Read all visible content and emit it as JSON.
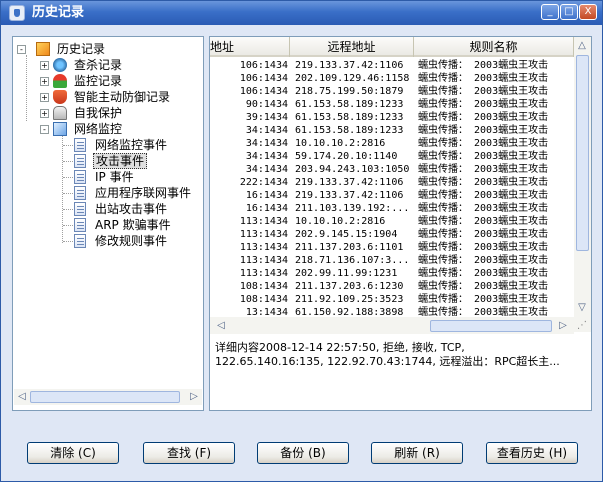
{
  "window": {
    "title": "历史记录",
    "controls": {
      "minimize": "_",
      "maximize": "□",
      "close": "X"
    }
  },
  "tree": {
    "root": {
      "label": "历史记录",
      "icon": "history-folder-icon"
    },
    "children": [
      {
        "label": "查杀记录",
        "icon": "scan-icon",
        "expander": "+"
      },
      {
        "label": "监控记录",
        "icon": "umbrella-icon",
        "expander": "+"
      },
      {
        "label": "智能主动防御记录",
        "icon": "defense-icon",
        "expander": "+"
      },
      {
        "label": "自我保护",
        "icon": "lock-icon",
        "expander": "+"
      },
      {
        "label": "网络监控",
        "icon": "network-icon",
        "expander": "-",
        "children": [
          {
            "label": "网络监控事件"
          },
          {
            "label": "攻击事件",
            "selected": true
          },
          {
            "label": "IP 事件"
          },
          {
            "label": "应用程序联网事件"
          },
          {
            "label": "出站攻击事件"
          },
          {
            "label": "ARP 欺骗事件"
          },
          {
            "label": "修改规则事件"
          }
        ]
      }
    ]
  },
  "grid": {
    "columns": [
      "地址",
      "远程地址",
      "规则名称"
    ],
    "rows": [
      [
        "106:1434",
        "219.133.37.42:1106",
        "蠕虫传播： 2003蠕虫王攻击"
      ],
      [
        "106:1434",
        "202.109.129.46:1158",
        "蠕虫传播： 2003蠕虫王攻击"
      ],
      [
        "106:1434",
        "218.75.199.50:1879",
        "蠕虫传播： 2003蠕虫王攻击"
      ],
      [
        "90:1434",
        "61.153.58.189:1233",
        "蠕虫传播： 2003蠕虫王攻击"
      ],
      [
        "39:1434",
        "61.153.58.189:1233",
        "蠕虫传播： 2003蠕虫王攻击"
      ],
      [
        "34:1434",
        "61.153.58.189:1233",
        "蠕虫传播： 2003蠕虫王攻击"
      ],
      [
        "34:1434",
        "10.10.10.2:2816",
        "蠕虫传播： 2003蠕虫王攻击"
      ],
      [
        "34:1434",
        "59.174.20.10:1140",
        "蠕虫传播： 2003蠕虫王攻击"
      ],
      [
        "34:1434",
        "203.94.243.103:1050",
        "蠕虫传播： 2003蠕虫王攻击"
      ],
      [
        "222:1434",
        "219.133.37.42:1106",
        "蠕虫传播： 2003蠕虫王攻击"
      ],
      [
        "16:1434",
        "219.133.37.42:1106",
        "蠕虫传播： 2003蠕虫王攻击"
      ],
      [
        "16:1434",
        "211.103.139.192:...",
        "蠕虫传播： 2003蠕虫王攻击"
      ],
      [
        "113:1434",
        "10.10.10.2:2816",
        "蠕虫传播： 2003蠕虫王攻击"
      ],
      [
        "113:1434",
        "202.9.145.15:1904",
        "蠕虫传播： 2003蠕虫王攻击"
      ],
      [
        "113:1434",
        "211.137.203.6:1101",
        "蠕虫传播： 2003蠕虫王攻击"
      ],
      [
        "113:1434",
        "218.71.136.107:3...",
        "蠕虫传播： 2003蠕虫王攻击"
      ],
      [
        "113:1434",
        "202.99.11.99:1231",
        "蠕虫传播： 2003蠕虫王攻击"
      ],
      [
        "108:1434",
        "211.137.203.6:1230",
        "蠕虫传播： 2003蠕虫王攻击"
      ],
      [
        "108:1434",
        "211.92.109.25:3523",
        "蠕虫传播： 2003蠕虫王攻击"
      ],
      [
        "13:1434",
        "61.150.92.188:3898",
        "蠕虫传播： 2003蠕虫王攻击"
      ]
    ]
  },
  "detail": {
    "line1": "详细内容2008-12-14 22:57:50, 拒绝, 接收, TCP,",
    "line2": "122.65.140.16:135, 122.92.70.43:1744, 远程溢出：RPC超长主..."
  },
  "buttons": [
    "清除 (C)",
    "查找 (F)",
    "备份 (B)",
    "刷新 (R)",
    "查看历史 (H)"
  ],
  "scroll_arrows": {
    "left": "◁",
    "right": "▷",
    "up": "△",
    "down": "▽",
    "grip": "⋰"
  }
}
